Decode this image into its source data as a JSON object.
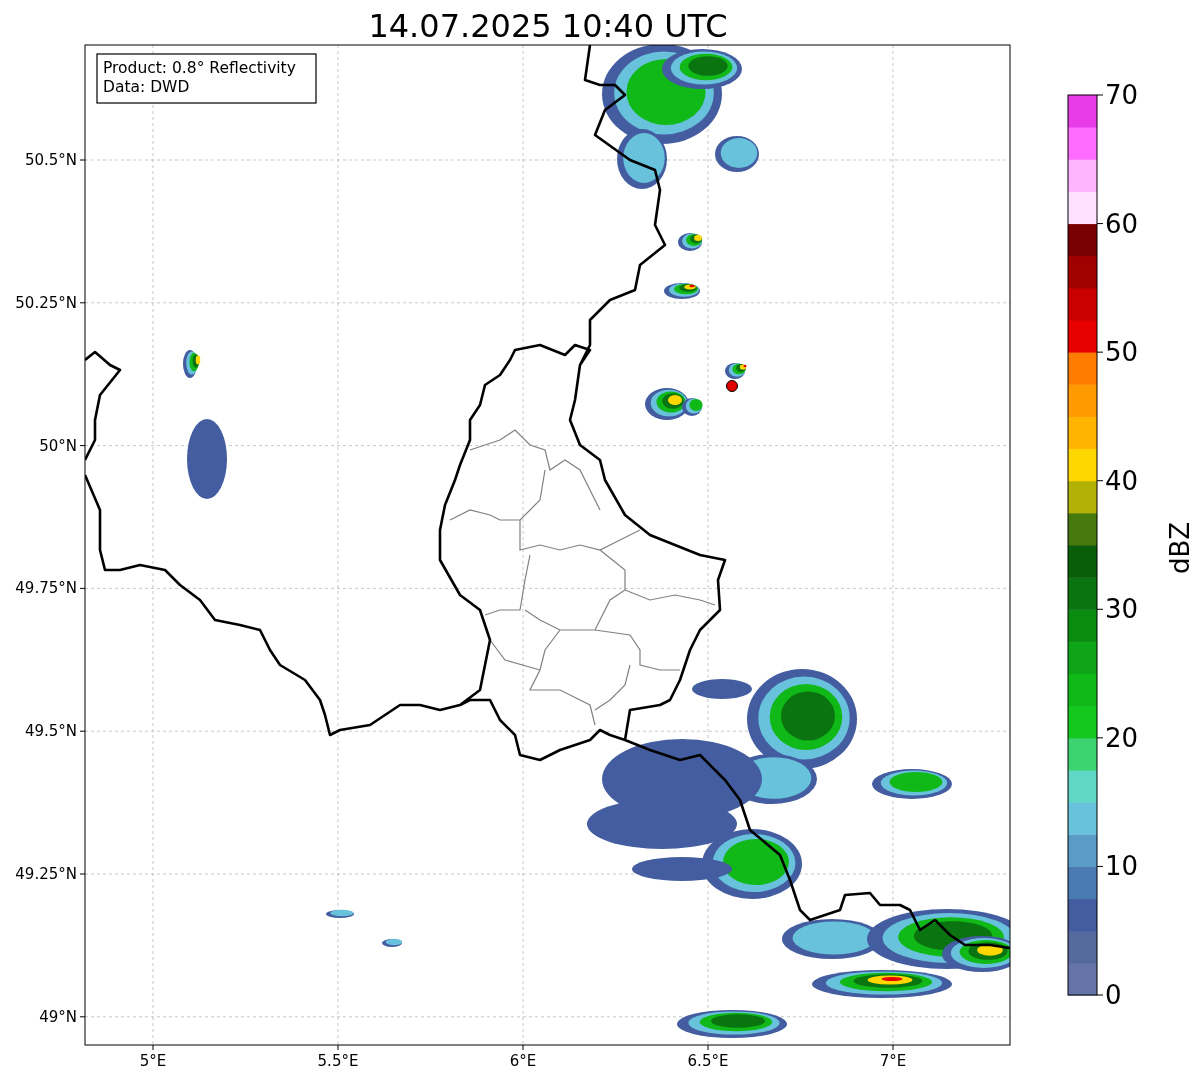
{
  "title": "14.07.2025 10:40 UTC",
  "info_box": [
    "Product: 0.8° Reflectivity",
    "Data: DWD"
  ],
  "y_ticks": [
    "50.5°N",
    "50.25°N",
    "50°N",
    "49.75°N",
    "49.5°N",
    "49.25°N",
    "49°N"
  ],
  "x_ticks": [
    "5°E",
    "5.5°E",
    "6°E",
    "6.5°E",
    "7°E"
  ],
  "colorbar": {
    "label": "dBZ",
    "ticks": [
      "70",
      "60",
      "50",
      "40",
      "30",
      "20",
      "10",
      "0"
    ]
  }
}
